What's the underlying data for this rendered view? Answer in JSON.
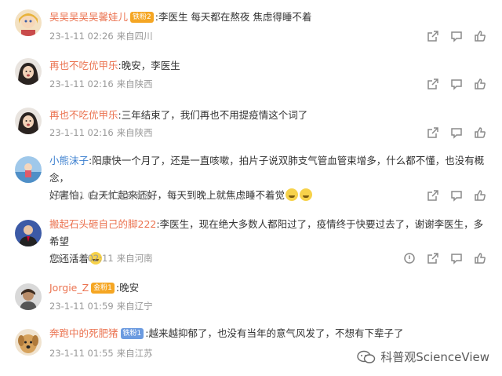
{
  "comments": [
    {
      "username": "吴吴吴吴吴馨娃儿",
      "username_color": "orange",
      "badge": "铁粉2",
      "badge_color": "orange",
      "text": ":李医生  每天都在熬夜 焦虑得睡不着",
      "time": "23-1-11 02:26",
      "location": "来自四川",
      "actions": [
        "share-icon",
        "reply-icon",
        "like-icon"
      ]
    },
    {
      "username": "再也不吃优甲乐",
      "username_color": "orange",
      "badge": "",
      "text": ":晚安，李医生",
      "time": "23-1-11 02:16",
      "location": "来自陕西",
      "actions": [
        "share-icon",
        "reply-icon",
        "like-icon"
      ]
    },
    {
      "username": "再也不吃优甲乐",
      "username_color": "orange",
      "badge": "",
      "text": ":三年结束了，我们再也不用提疫情这个词了",
      "time": "23-1-11 02:16",
      "location": "来自陕西",
      "actions": [
        "share-icon",
        "reply-icon",
        "like-icon"
      ]
    },
    {
      "username": "小熊沫子",
      "username_color": "blue",
      "badge": "",
      "text_line1": ":阳康快一个月了，还是一直咳嗽，拍片子说双肺支气管血管束增多，什么都不懂，也没有概念，",
      "text_line2": "好害怕，白天忙起来还好，每天到晚上就焦虑睡不着觉",
      "time": "23-1-11 02:13",
      "location": "来自青海",
      "actions": [
        "share-icon",
        "reply-icon",
        "like-icon"
      ]
    },
    {
      "username": "搬起石头砸自己的脚222",
      "username_color": "orange",
      "badge": "",
      "text_line1": ":李医生，现在绝大多数人都阳过了，疫情终于快要过去了，谢谢李医生，多希望",
      "text_line2": "您还活着",
      "time": "23-1-11 02:11",
      "location": "来自河南",
      "actions": [
        "report-icon",
        "share-icon",
        "reply-icon",
        "like-icon"
      ]
    },
    {
      "username": "Jorgie_Z",
      "username_color": "orange",
      "badge": "金粉1",
      "badge_color": "orange",
      "text": ":晚安",
      "time": "23-1-11 01:59",
      "location": "来自辽宁",
      "actions": [
        "share-icon",
        "reply-icon",
        "like-icon"
      ]
    },
    {
      "username": "奔跑中的死肥猪",
      "username_color": "orange",
      "badge": "铁粉1",
      "badge_color": "blue",
      "text": ":越来越抑郁了，也没有当年的意气风发了，不想有下辈子了",
      "time": "23-1-11 01:55",
      "location": "来自江苏",
      "actions": []
    }
  ],
  "watermark": "科普观ScienceView",
  "colors": {
    "username_orange": "#eb7350",
    "username_blue": "#3b7fcf",
    "meta_gray": "#999999",
    "text": "#333333"
  }
}
